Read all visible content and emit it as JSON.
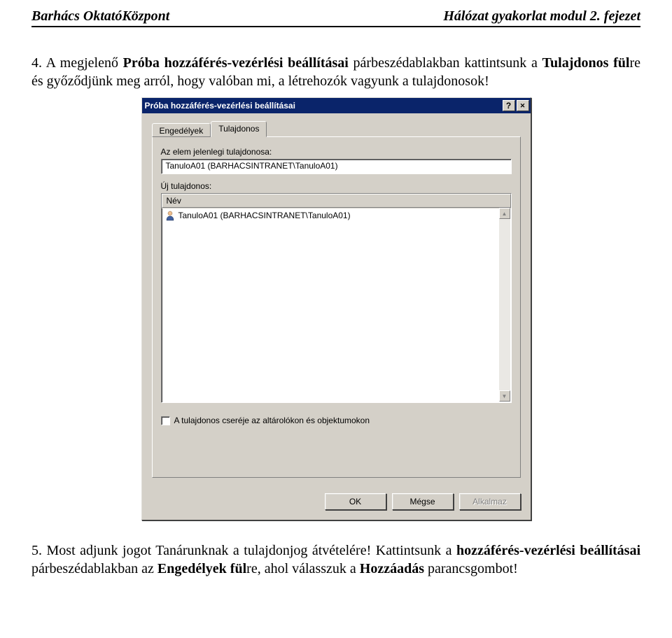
{
  "doc": {
    "header_left": "Barhács OktatóKözpont",
    "header_right": "Hálózat gyakorlat modul 2. fejezet",
    "p4_num": "4.",
    "p4_a": "A megjelenő ",
    "p4_b1": "Próba hozzáférés-vezérlési beállításai",
    "p4_c": " párbeszédablakban kattintsunk a ",
    "p4_b2": "Tulajdonos fül",
    "p4_d": "re és győződjünk meg arról, hogy valóban mi, a létrehozók vagyunk a tulajdonosok!",
    "p5_num": "5.",
    "p5_a": "Most adjunk jogot Tanárunknak a tulajdonjog átvételére! Kattintsunk a ",
    "p5_b1": "hozzáférés-vezérlési beállításai",
    "p5_c": " párbeszédablakban az ",
    "p5_b2": "Engedélyek fül",
    "p5_d": "re, ahol válasszuk a ",
    "p5_b3": "Hozzáadás",
    "p5_e": " parancsgombot!"
  },
  "dialog": {
    "title": "Próba hozzáférés-vezérlési beállításai",
    "tab_permissions": "Engedélyek",
    "tab_owner": "Tulajdonos",
    "current_owner_label": "Az elem jelenlegi tulajdonosa:",
    "current_owner_value": "TanuloA01 (BARHACSINTRANET\\TanuloA01)",
    "new_owner_label": "Új tulajdonos:",
    "col_name": "Név",
    "list_row_text": "TanuloA01 (BARHACSINTRANET\\TanuloA01)",
    "checkbox_label": "A tulajdonos cseréje az altárolókon és objektumokon",
    "btn_ok": "OK",
    "btn_cancel": "Mégse",
    "btn_apply": "Alkalmaz"
  }
}
